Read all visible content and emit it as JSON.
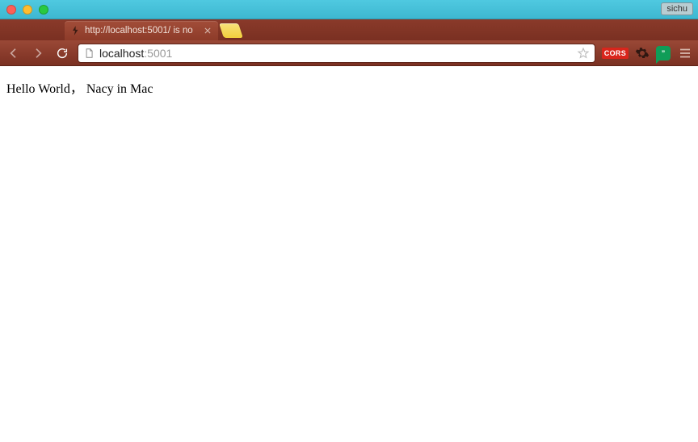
{
  "window": {
    "profile_name": "sichu"
  },
  "tabs": [
    {
      "title": "http://localhost:5001/ is no"
    }
  ],
  "toolbar": {
    "url_host": "localhost",
    "url_port": ":5001",
    "extensions": {
      "cors_label": "CORS",
      "hangouts_symbol": "”"
    }
  },
  "page": {
    "body_text": "Hello World， Nacy in Mac"
  }
}
